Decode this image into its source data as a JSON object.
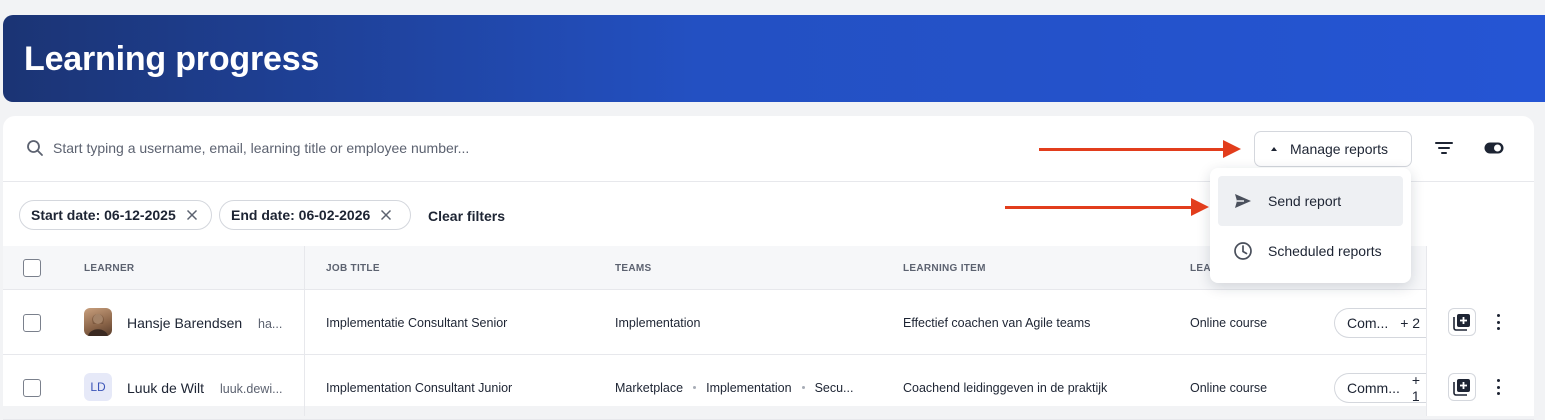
{
  "header": {
    "title": "Learning progress"
  },
  "search": {
    "placeholder": "Start typing a username, email, learning title or employee number..."
  },
  "toolbar": {
    "manage_reports_label": "Manage reports"
  },
  "filters": {
    "chips": [
      {
        "label": "Start date: 06-12-2025"
      },
      {
        "label": "End date: 06-02-2026"
      }
    ],
    "clear_label": "Clear filters"
  },
  "table": {
    "columns": [
      "LEARNER",
      "JOB TITLE",
      "TEAMS",
      "LEARNING ITEM",
      "LEA"
    ],
    "rows": [
      {
        "learner_name": "Hansje Barendsen",
        "learner_email": "ha...",
        "avatar_type": "photo",
        "job_title": "Implementatie Consultant Senior",
        "teams": [
          "Implementation"
        ],
        "learning_item": "Effectief coachen van Agile teams",
        "learning_type": "Online course",
        "status": "Com...",
        "status_more": "+ 2"
      },
      {
        "learner_name": "Luuk de Wilt",
        "learner_email": "luuk.dewi...",
        "avatar_type": "initials",
        "avatar_initials": "LD",
        "job_title": "Implementation Consultant Junior",
        "teams": [
          "Marketplace",
          "Implementation",
          "Secu..."
        ],
        "learning_item": "Coachend leidinggeven in de praktijk",
        "learning_type": "Online course",
        "status": "Comm...",
        "status_more": "+ 1"
      }
    ]
  },
  "dropdown": {
    "items": [
      {
        "label": "Send report",
        "icon": "send-icon"
      },
      {
        "label": "Scheduled reports",
        "icon": "clock-icon"
      }
    ]
  },
  "colors": {
    "banner_start": "#1b3474",
    "banner_end": "#2555d4",
    "annotation_arrow": "#e23d1c"
  }
}
